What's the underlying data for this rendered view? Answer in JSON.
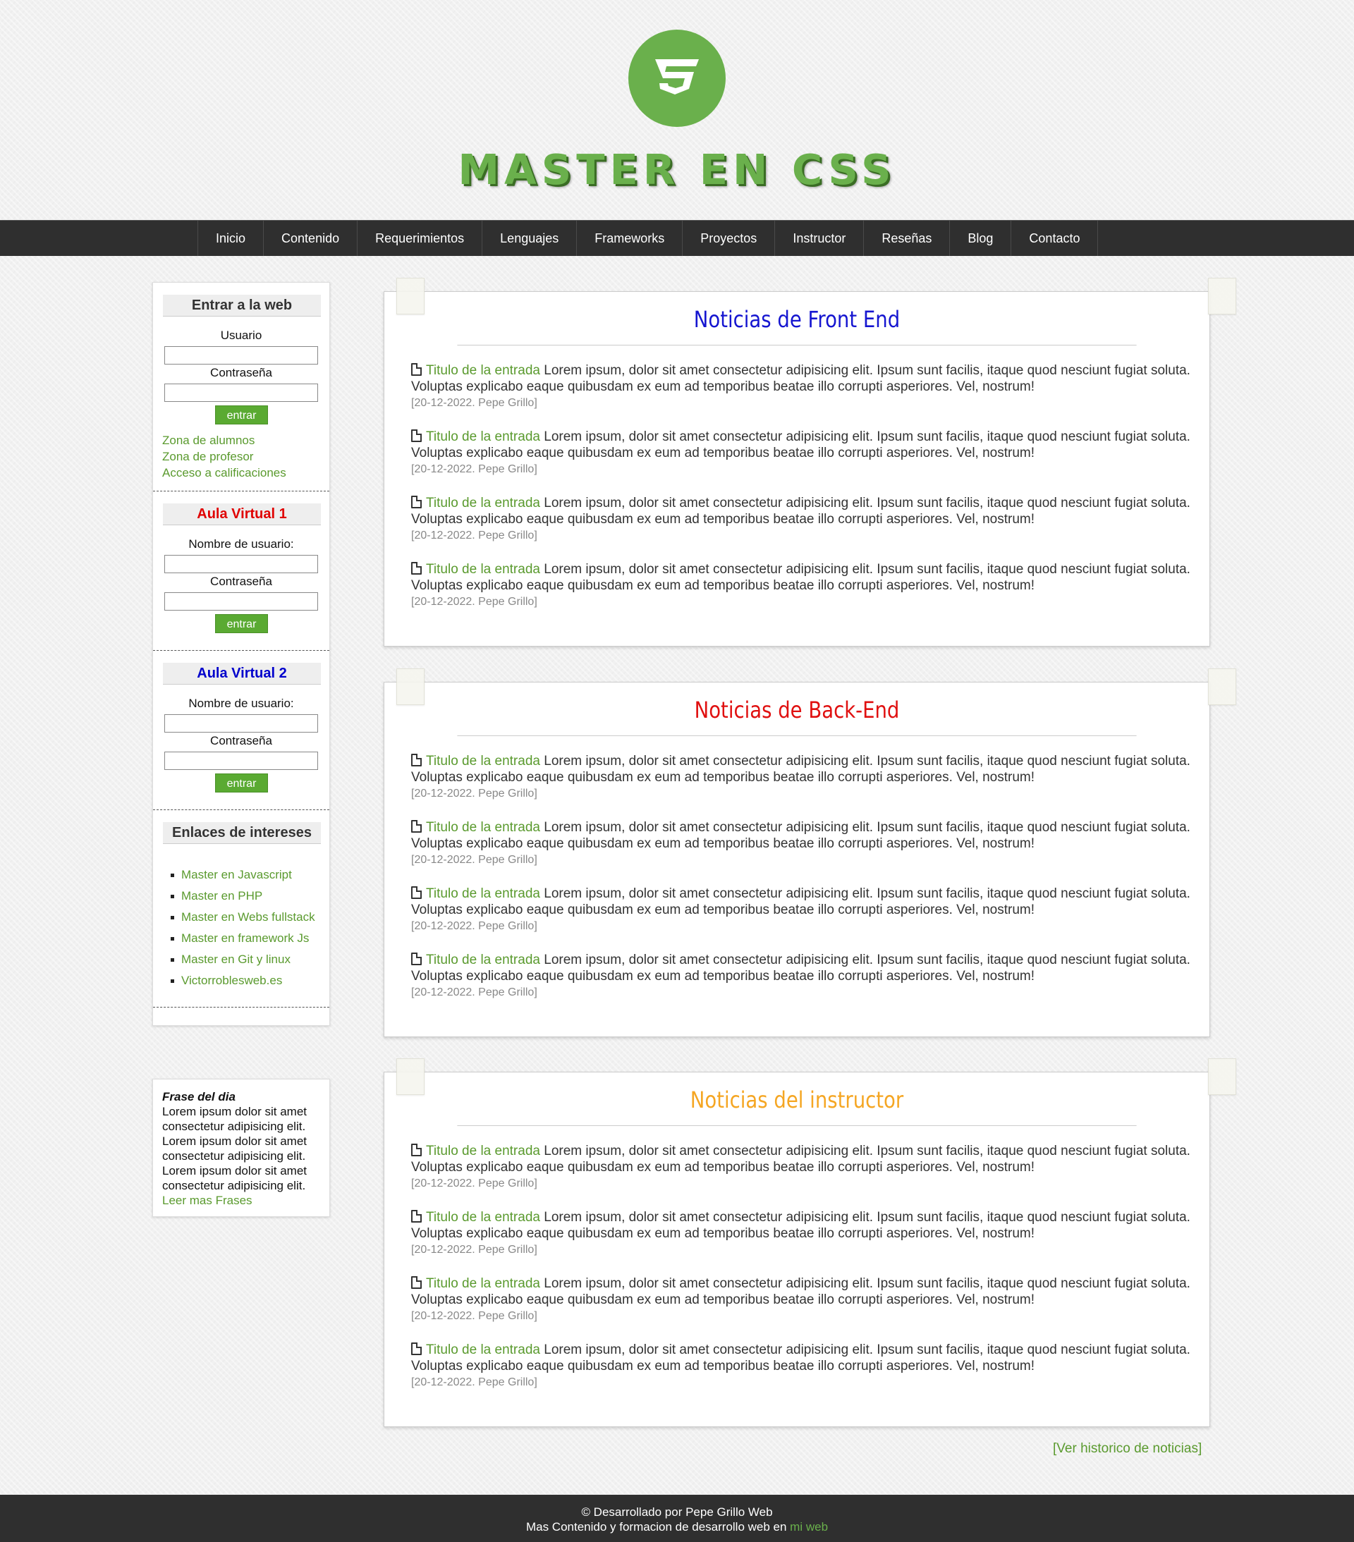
{
  "header": {
    "logo_text": "MASTER EN CSS",
    "logo_icon": "css3-shield-icon",
    "brand_color": "#6ab04c"
  },
  "nav": {
    "items": [
      "Inicio",
      "Contenido",
      "Requerimientos",
      "Lenguajes",
      "Frameworks",
      "Proyectos",
      "Instructor",
      "Reseñas",
      "Blog",
      "Contacto"
    ]
  },
  "sidebar": {
    "login": {
      "title": "Entrar a la web",
      "user_label": "Usuario",
      "pass_label": "Contraseña",
      "button": "entrar",
      "links": [
        "Zona de alumnos",
        "Zona de profesor",
        "Acceso a calificaciones"
      ]
    },
    "aula1": {
      "title": "Aula Virtual 1",
      "title_color": "#e00000",
      "user_label": "Nombre de usuario:",
      "pass_label": "Contraseña",
      "button": "entrar"
    },
    "aula2": {
      "title": "Aula Virtual 2",
      "title_color": "#0000cc",
      "user_label": "Nombre de usuario:",
      "pass_label": "Contraseña",
      "button": "entrar"
    },
    "links": {
      "title": "Enlaces de intereses",
      "items": [
        "Master en Javascript",
        "Master en PHP",
        "Master en Webs fullstack",
        "Master en framework Js",
        "Master en Git y linux",
        "Victorroblesweb.es"
      ]
    },
    "quote": {
      "title": "Frase del dia",
      "text": "Lorem ipsum dolor sit amet consectetur adipisicing elit. Lorem ipsum dolor sit amet consectetur adipisicing elit. Lorem ipsum dolor sit amet consectetur adipisicing elit.",
      "link": "Leer mas Frases"
    }
  },
  "news": [
    {
      "title": "Noticias de Front End",
      "color": "#1515d0",
      "posts": [
        {
          "title": "Titulo de la entrada",
          "text": " Lorem ipsum, dolor sit amet consectetur adipisicing elit. Ipsum sunt facilis, itaque quod nesciunt fugiat soluta. Voluptas explicabo eaque quibusdam ex eum ad temporibus beatae illo corrupti asperiores. Vel, nostrum!",
          "date": "[20-12-2022. Pepe Grillo]"
        },
        {
          "title": "Titulo de la entrada",
          "text": " Lorem ipsum, dolor sit amet consectetur adipisicing elit. Ipsum sunt facilis, itaque quod nesciunt fugiat soluta. Voluptas explicabo eaque quibusdam ex eum ad temporibus beatae illo corrupti asperiores. Vel, nostrum!",
          "date": "[20-12-2022. Pepe Grillo]"
        },
        {
          "title": "Titulo de la entrada",
          "text": " Lorem ipsum, dolor sit amet consectetur adipisicing elit. Ipsum sunt facilis, itaque quod nesciunt fugiat soluta. Voluptas explicabo eaque quibusdam ex eum ad temporibus beatae illo corrupti asperiores. Vel, nostrum!",
          "date": "[20-12-2022. Pepe Grillo]"
        },
        {
          "title": "Titulo de la entrada",
          "text": " Lorem ipsum, dolor sit amet consectetur adipisicing elit. Ipsum sunt facilis, itaque quod nesciunt fugiat soluta. Voluptas explicabo eaque quibusdam ex eum ad temporibus beatae illo corrupti asperiores. Vel, nostrum!",
          "date": "[20-12-2022. Pepe Grillo]"
        }
      ]
    },
    {
      "title": "Noticias de Back-End",
      "color": "#e01010",
      "posts": [
        {
          "title": "Titulo de la entrada",
          "text": " Lorem ipsum, dolor sit amet consectetur adipisicing elit. Ipsum sunt facilis, itaque quod nesciunt fugiat soluta. Voluptas explicabo eaque quibusdam ex eum ad temporibus beatae illo corrupti asperiores. Vel, nostrum!",
          "date": "[20-12-2022. Pepe Grillo]"
        },
        {
          "title": "Titulo de la entrada",
          "text": " Lorem ipsum, dolor sit amet consectetur adipisicing elit. Ipsum sunt facilis, itaque quod nesciunt fugiat soluta. Voluptas explicabo eaque quibusdam ex eum ad temporibus beatae illo corrupti asperiores. Vel, nostrum!",
          "date": "[20-12-2022. Pepe Grillo]"
        },
        {
          "title": "Titulo de la entrada",
          "text": " Lorem ipsum, dolor sit amet consectetur adipisicing elit. Ipsum sunt facilis, itaque quod nesciunt fugiat soluta. Voluptas explicabo eaque quibusdam ex eum ad temporibus beatae illo corrupti asperiores. Vel, nostrum!",
          "date": "[20-12-2022. Pepe Grillo]"
        },
        {
          "title": "Titulo de la entrada",
          "text": " Lorem ipsum, dolor sit amet consectetur adipisicing elit. Ipsum sunt facilis, itaque quod nesciunt fugiat soluta. Voluptas explicabo eaque quibusdam ex eum ad temporibus beatae illo corrupti asperiores. Vel, nostrum!",
          "date": "[20-12-2022. Pepe Grillo]"
        }
      ]
    },
    {
      "title": "Noticias del instructor",
      "color": "#f5a623",
      "posts": [
        {
          "title": "Titulo de la entrada",
          "text": " Lorem ipsum, dolor sit amet consectetur adipisicing elit. Ipsum sunt facilis, itaque quod nesciunt fugiat soluta. Voluptas explicabo eaque quibusdam ex eum ad temporibus beatae illo corrupti asperiores. Vel, nostrum!",
          "date": "[20-12-2022. Pepe Grillo]"
        },
        {
          "title": "Titulo de la entrada",
          "text": " Lorem ipsum, dolor sit amet consectetur adipisicing elit. Ipsum sunt facilis, itaque quod nesciunt fugiat soluta. Voluptas explicabo eaque quibusdam ex eum ad temporibus beatae illo corrupti asperiores. Vel, nostrum!",
          "date": "[20-12-2022. Pepe Grillo]"
        },
        {
          "title": "Titulo de la entrada",
          "text": " Lorem ipsum, dolor sit amet consectetur adipisicing elit. Ipsum sunt facilis, itaque quod nesciunt fugiat soluta. Voluptas explicabo eaque quibusdam ex eum ad temporibus beatae illo corrupti asperiores. Vel, nostrum!",
          "date": "[20-12-2022. Pepe Grillo]"
        },
        {
          "title": "Titulo de la entrada",
          "text": " Lorem ipsum, dolor sit amet consectetur adipisicing elit. Ipsum sunt facilis, itaque quod nesciunt fugiat soluta. Voluptas explicabo eaque quibusdam ex eum ad temporibus beatae illo corrupti asperiores. Vel, nostrum!",
          "date": "[20-12-2022. Pepe Grillo]"
        }
      ]
    }
  ],
  "historic_link": "[Ver historico de noticias]",
  "footer": {
    "line1": "© Desarrollado por Pepe Grillo Web",
    "line2_prefix": "Mas Contenido y formacion de desarrollo web en ",
    "line2_link": "mi web"
  }
}
